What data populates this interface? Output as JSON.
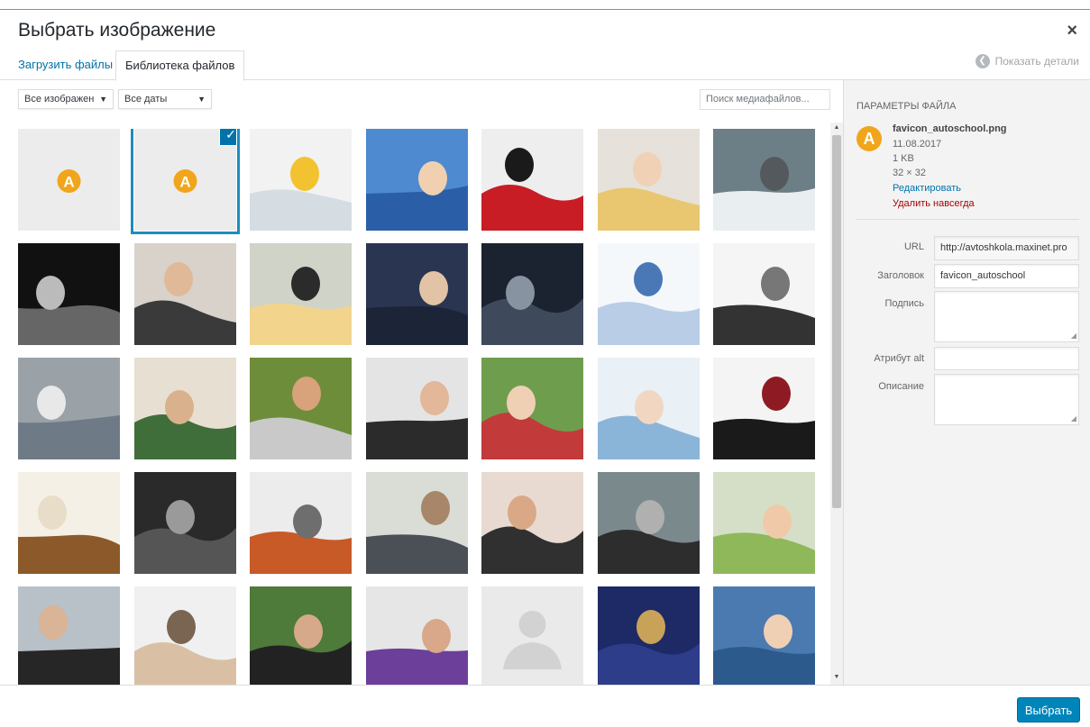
{
  "modal": {
    "title": "Выбрать изображение",
    "close_label": "×"
  },
  "tabs": {
    "upload": "Загрузить файлы",
    "library": "Библиотека файлов",
    "show_details": "Показать детали"
  },
  "filters": {
    "type_value": "Все изображен",
    "date_value": "Все даты",
    "search_placeholder": "Поиск медиафайлов..."
  },
  "grid": {
    "selected_index": 1,
    "items": [
      {
        "kind": "logo"
      },
      {
        "kind": "logo"
      },
      {
        "kind": "photo",
        "c": [
          "#f2f2f2",
          "#d5dde3",
          "#f2c230"
        ]
      },
      {
        "kind": "photo",
        "c": [
          "#4d8ad0",
          "#2a5fa8",
          "#f0d0b0"
        ]
      },
      {
        "kind": "photo",
        "c": [
          "#eeeeee",
          "#c81d25",
          "#1a1a1a"
        ]
      },
      {
        "kind": "photo",
        "c": [
          "#e6e1da",
          "#e8c770",
          "#f1d1b5"
        ]
      },
      {
        "kind": "photo",
        "c": [
          "#6d7f86",
          "#e9eef0",
          "#53595c"
        ]
      },
      {
        "kind": "photo",
        "c": [
          "#111111",
          "#666666",
          "#bbbbbb"
        ]
      },
      {
        "kind": "photo",
        "c": [
          "#d8d2ca",
          "#3a3a3a",
          "#e0b998"
        ]
      },
      {
        "kind": "photo",
        "c": [
          "#cfd3c8",
          "#f3d48c",
          "#2b2b2b"
        ]
      },
      {
        "kind": "photo",
        "c": [
          "#2a3552",
          "#1c2438",
          "#e3c3a5"
        ]
      },
      {
        "kind": "photo",
        "c": [
          "#1c2330",
          "#3e4a5c",
          "#8893a2"
        ]
      },
      {
        "kind": "photo",
        "c": [
          "#f5f8fb",
          "#b9cde6",
          "#4a78b6"
        ]
      },
      {
        "kind": "photo",
        "c": [
          "#f5f5f5",
          "#333333",
          "#777777"
        ]
      },
      {
        "kind": "photo",
        "c": [
          "#9aa2a8",
          "#6e7a86",
          "#e8e8e8"
        ]
      },
      {
        "kind": "photo",
        "c": [
          "#e6dfd2",
          "#3f6e3a",
          "#d9b28d"
        ]
      },
      {
        "kind": "photo",
        "c": [
          "#6e8d3a",
          "#c9c9c9",
          "#d8a27a"
        ]
      },
      {
        "kind": "photo",
        "c": [
          "#e4e4e4",
          "#2b2b2b",
          "#e2b79a"
        ]
      },
      {
        "kind": "photo",
        "c": [
          "#6f9d4e",
          "#c23a3a",
          "#f0d0b5"
        ]
      },
      {
        "kind": "photo",
        "c": [
          "#e9f0f6",
          "#8bb4d9",
          "#f1d7c2"
        ]
      },
      {
        "kind": "photo",
        "c": [
          "#f4f4f4",
          "#1a1a1a",
          "#8e1b24"
        ]
      },
      {
        "kind": "photo",
        "c": [
          "#f5f0e6",
          "#8c5a2a",
          "#e8ddc8"
        ]
      },
      {
        "kind": "photo",
        "c": [
          "#2a2a2a",
          "#555555",
          "#9a9a9a"
        ]
      },
      {
        "kind": "photo",
        "c": [
          "#ececec",
          "#c85a28",
          "#6e6e6e"
        ]
      },
      {
        "kind": "photo",
        "c": [
          "#d9ddd6",
          "#4b4f56",
          "#a88669"
        ]
      },
      {
        "kind": "photo",
        "c": [
          "#e8dad0",
          "#303030",
          "#d9a886"
        ]
      },
      {
        "kind": "photo",
        "c": [
          "#7a8a8c",
          "#2d2d2d",
          "#b0b0b0"
        ]
      },
      {
        "kind": "photo",
        "c": [
          "#d5dfc7",
          "#8fb85a",
          "#f0caa8"
        ]
      },
      {
        "kind": "photo",
        "c": [
          "#b8c0c8",
          "#262626",
          "#d9b496"
        ]
      },
      {
        "kind": "photo",
        "c": [
          "#f0f0f0",
          "#d9c0a5",
          "#7a6552"
        ]
      },
      {
        "kind": "photo",
        "c": [
          "#4e7a3a",
          "#222222",
          "#d6a98a"
        ]
      },
      {
        "kind": "photo",
        "c": [
          "#e6e6e6",
          "#6c3f9a",
          "#d9a789"
        ]
      },
      {
        "kind": "placeholder"
      },
      {
        "kind": "photo",
        "c": [
          "#1e2a66",
          "#2d3d8a",
          "#c9a25a"
        ]
      },
      {
        "kind": "photo",
        "c": [
          "#4b7ab0",
          "#2d5a8c",
          "#f0d0b5"
        ]
      }
    ],
    "logo_letter": "A",
    "check_glyph": "✓"
  },
  "details": {
    "heading": "Параметры файла",
    "icon_letter": "A",
    "filename": "favicon_autoschool.png",
    "date": "11.08.2017",
    "size": "1 KB",
    "dimensions": "32 × 32",
    "edit_link": "Редактировать",
    "delete_link": "Удалить навсегда",
    "fields": {
      "url_label": "URL",
      "url_value": "http://avtoshkola.maxinet.pro",
      "title_label": "Заголовок",
      "title_value": "favicon_autoschool",
      "caption_label": "Подпись",
      "caption_value": "",
      "alt_label": "Атрибут alt",
      "alt_value": "",
      "description_label": "Описание",
      "description_value": ""
    }
  },
  "footer": {
    "select_button": "Выбрать"
  },
  "colors": {
    "accent": "#0085ba",
    "link": "#0073aa",
    "delete": "#a00000",
    "logo": "#f0a51b"
  }
}
